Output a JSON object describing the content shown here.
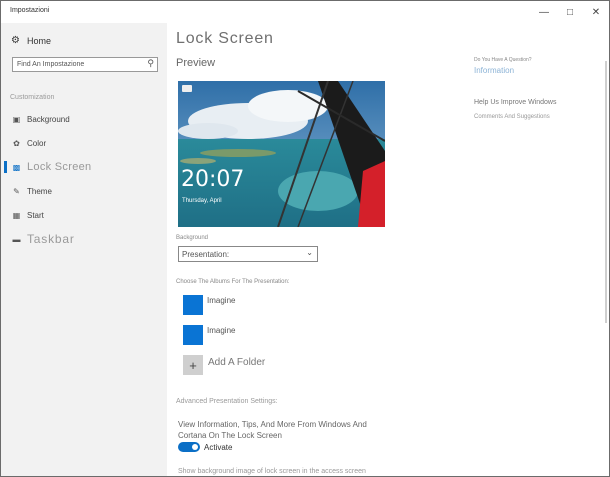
{
  "window": {
    "title": "Impostazioni",
    "minimize_icon": "minimize-icon",
    "maximize_icon": "maximize-icon",
    "close_icon": "close-icon"
  },
  "sidebar": {
    "home_label": "Home",
    "search_text": "Find An Impostazione",
    "section_header": "Customization",
    "items": [
      {
        "label": "Background",
        "icon": "picture-icon"
      },
      {
        "label": "Color",
        "icon": "palette-icon"
      },
      {
        "label": "Lock Screen",
        "icon": "lock-screen-icon",
        "active": true
      },
      {
        "label": "Theme",
        "icon": "brush-icon"
      },
      {
        "label": "Start",
        "icon": "start-icon"
      },
      {
        "label": "Taskbar",
        "icon": "taskbar-icon"
      }
    ]
  },
  "main": {
    "title": "Lock Screen",
    "preview_label": "Preview",
    "preview_time": "20:07",
    "preview_date": "Thursday, April",
    "background_label": "Background",
    "background_value": "Presentation:",
    "albums_label": "Choose The Albums For The Presentation:",
    "albums": [
      "Imagine",
      "Imagine"
    ],
    "add_folder_label": "Add A Folder",
    "advanced_link": "Advanced Presentation Settings:",
    "tips_desc": "View Information, Tips, And More From Windows And Cortana On The Lock Screen",
    "toggle_state": "Activate",
    "cut_text": "Show background image of lock screen in the access screen"
  },
  "right": {
    "question": "Do You Have A Question?",
    "info_link": "Information",
    "help_heading": "Help Us Improve Windows",
    "comments_link": "Comments And Suggestions"
  },
  "colors": {
    "accent": "#0b6fc6",
    "album_tile": "#0a74d4",
    "sidebar_bg": "#f2f2f2"
  }
}
